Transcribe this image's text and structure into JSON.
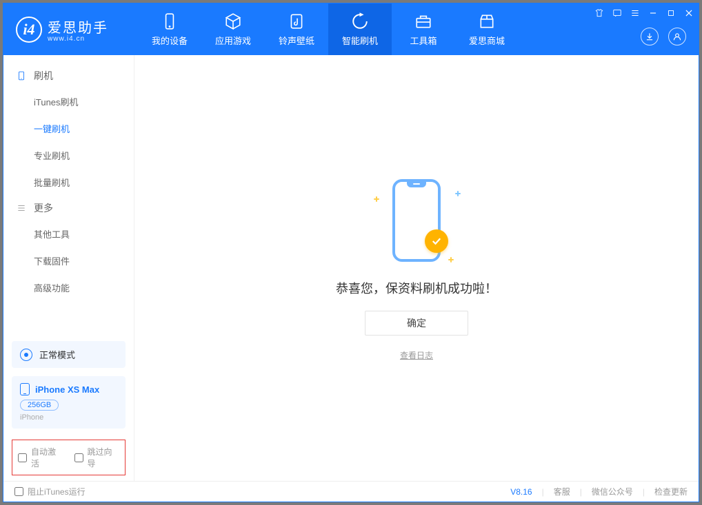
{
  "header": {
    "logo_cn": "爱思助手",
    "logo_url": "www.i4.cn",
    "nav": {
      "device": "我的设备",
      "apps": "应用游戏",
      "ringtones": "铃声壁纸",
      "flash": "智能刷机",
      "toolbox": "工具箱",
      "store": "爱思商城"
    }
  },
  "sidebar": {
    "group_flash": "刷机",
    "items_flash": {
      "itunes": "iTunes刷机",
      "oneclick": "一键刷机",
      "pro": "专业刷机",
      "batch": "批量刷机"
    },
    "group_more": "更多",
    "items_more": {
      "other": "其他工具",
      "firmware": "下载固件",
      "advanced": "高级功能"
    },
    "status_mode": "正常模式",
    "device_name": "iPhone XS Max",
    "device_capacity": "256GB",
    "device_type": "iPhone",
    "cb_auto_activate": "自动激活",
    "cb_skip_setup": "跳过向导"
  },
  "main": {
    "success_text": "恭喜您，保资料刷机成功啦！",
    "ok_button": "确定",
    "view_log": "查看日志"
  },
  "statusbar": {
    "block_itunes": "阻止iTunes运行",
    "version": "V8.16",
    "support": "客服",
    "wechat": "微信公众号",
    "check_update": "检查更新"
  }
}
